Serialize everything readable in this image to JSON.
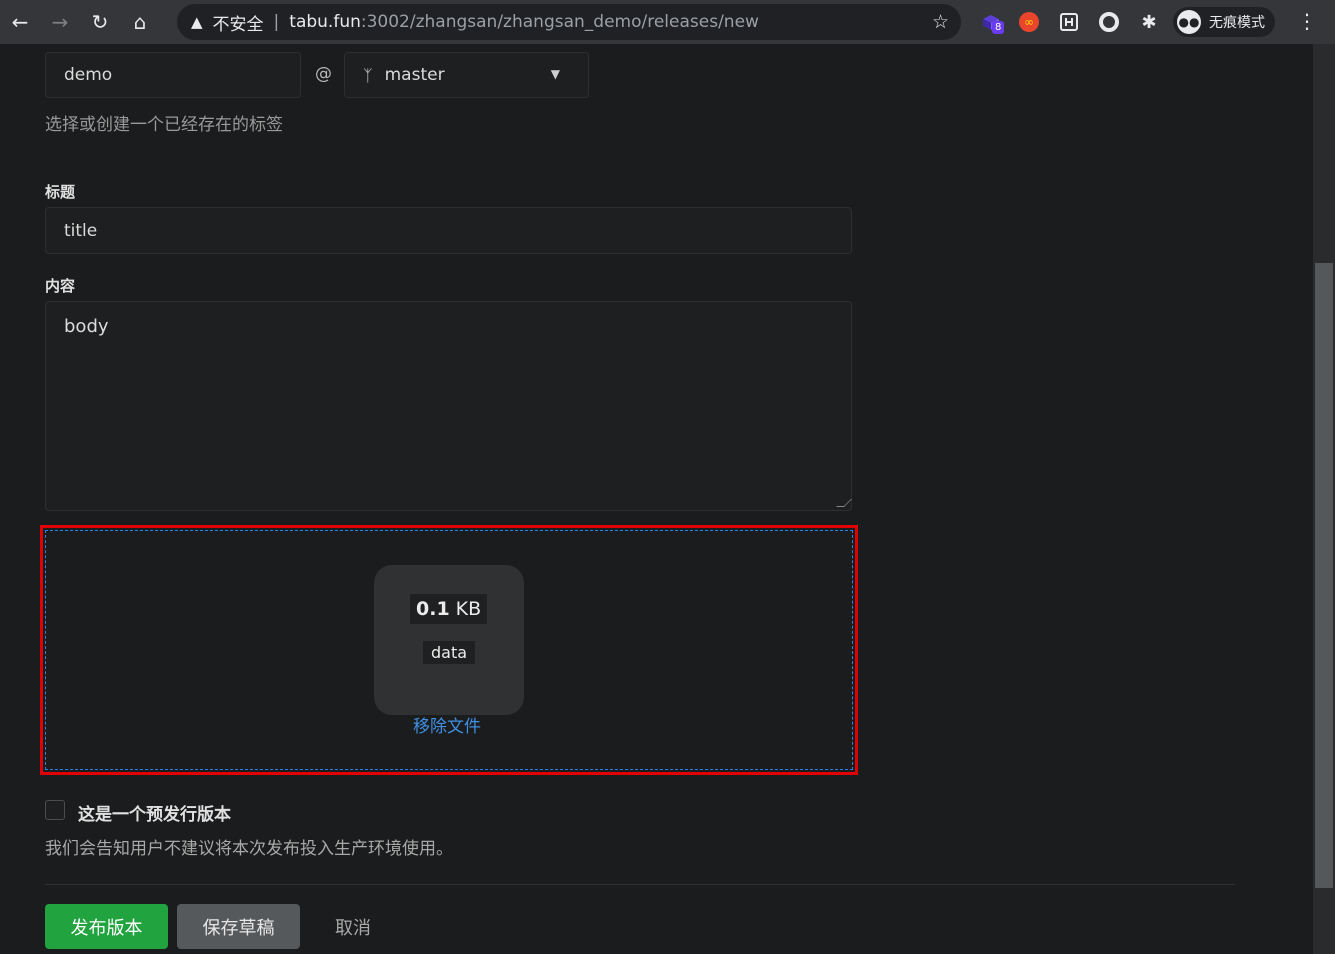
{
  "browser": {
    "security_warning": "不安全",
    "url_host": "tabu.fun",
    "url_path": ":3002/zhangsan/zhangsan_demo/releases/new",
    "extension_badge_count": "8",
    "incognito_label": "无痕模式"
  },
  "form": {
    "tag_value": "demo",
    "at_symbol": "@",
    "branch_value": "master",
    "tag_hint": "选择或创建一个已经存在的标签",
    "title_label": "标题",
    "title_value": "title",
    "content_label": "内容",
    "content_value": "body",
    "attachment": {
      "size_value": "0.1",
      "size_unit": "KB",
      "file_name": "data",
      "remove_label": "移除文件"
    },
    "prerelease_label": "这是一个预发行版本",
    "prerelease_desc": "我们会告知用户不建议将本次发布投入生产环境使用。",
    "buttons": {
      "publish": "发布版本",
      "save_draft": "保存草稿",
      "cancel": "取消"
    }
  },
  "colors": {
    "highlight": "#e00000",
    "primary": "#21a33f",
    "link": "#3f8fe4"
  }
}
